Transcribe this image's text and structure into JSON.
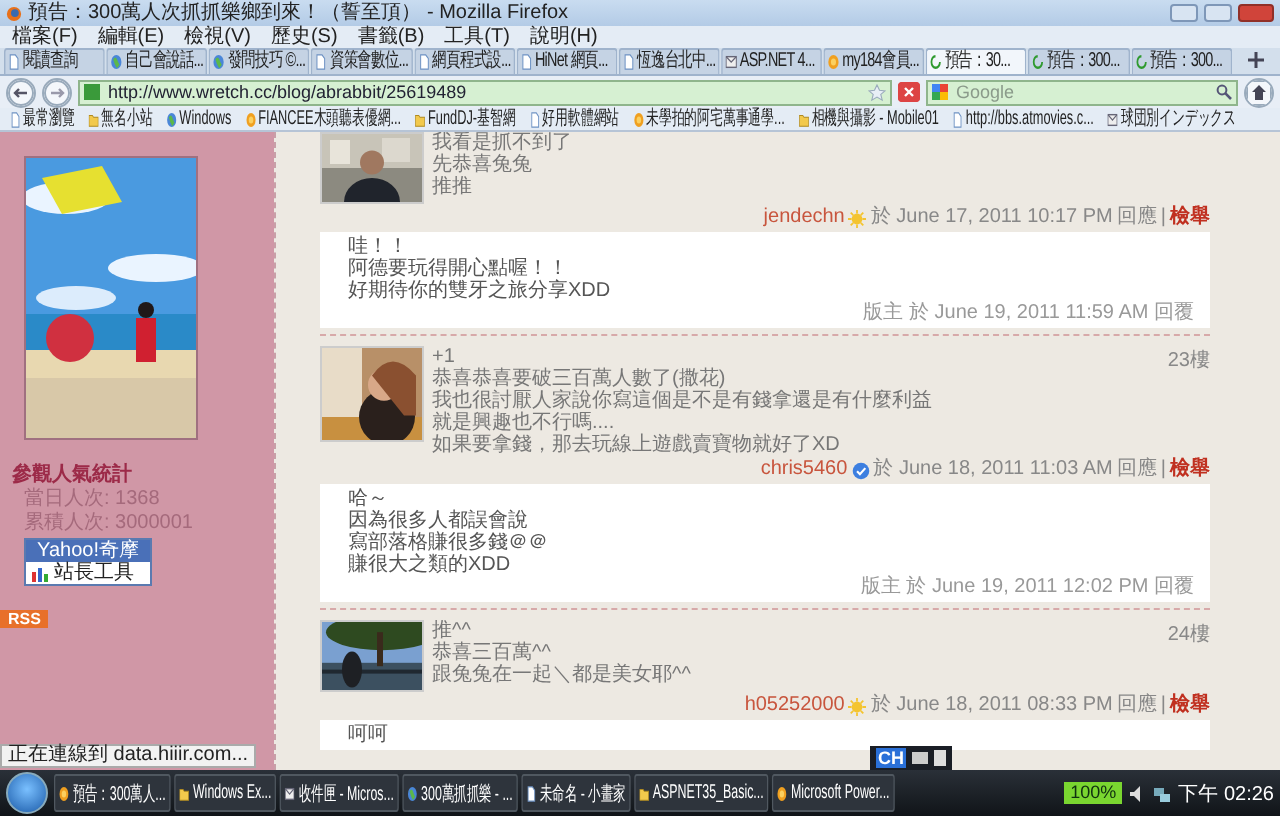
{
  "window": {
    "title": "預告：300萬人次抓抓樂鄉到來！（誓至頂） - Mozilla Firefox"
  },
  "menu": [
    "檔案(F)",
    "編輯(E)",
    "檢視(V)",
    "歷史(S)",
    "書籤(B)",
    "工具(T)",
    "說明(H)"
  ],
  "tabs": [
    {
      "label": "閱讀查詢",
      "selected": false
    },
    {
      "label": "自己會說話...",
      "selected": false
    },
    {
      "label": "發問技巧 ©...",
      "selected": false
    },
    {
      "label": "資策會數位...",
      "selected": false
    },
    {
      "label": "網頁程式設...",
      "selected": false
    },
    {
      "label": "HiNet 網頁...",
      "selected": false
    },
    {
      "label": "恆逸台北中...",
      "selected": false
    },
    {
      "label": "ASP.NET 4...",
      "selected": false
    },
    {
      "label": "my184會員...",
      "selected": false
    },
    {
      "label": "預告：30...",
      "selected": true
    },
    {
      "label": "預告：300...",
      "selected": false
    },
    {
      "label": "預告：300...",
      "selected": false
    }
  ],
  "address": {
    "value": "http://www.wretch.cc/blog/abrabbit/25619489"
  },
  "search": {
    "placeholder": "Google"
  },
  "bookmarks": [
    "最常瀏覽",
    "無名小站",
    "Windows",
    "FIANCEE木頭聽表優網...",
    "FundDJ-基智網",
    "好用軟體網站",
    "未學拍的阿宅萬事通學...",
    "相機與攝影 - Mobile01",
    "http://bbs.atmovies.c...",
    "球団別インデックス"
  ],
  "sidebar": {
    "stats_title": "參觀人氣統計",
    "stats": [
      "當日人次: 1368",
      "累積人次: 3000001"
    ],
    "badge_top": "Yahoo!奇摩",
    "badge_bottom": "站長工具",
    "rss": "RSS"
  },
  "comments": [
    {
      "lines": [
        "我看是抓不到了",
        "先恭喜兔兔",
        "推推"
      ],
      "author": "jendechn",
      "time": "於 June 17, 2011 10:17 PM",
      "reply_link": "回應",
      "separator": "|",
      "report_link": "檢舉",
      "reply": {
        "lines": [
          "哇！！",
          "阿德要玩得開心點喔！！",
          "好期待你的雙牙之旅分享XDD"
        ],
        "meta": "版主 於 June 19, 2011 11:59 AM 回覆"
      }
    },
    {
      "floor": "23樓",
      "lines": [
        "+1",
        "恭喜恭喜要破三百萬人數了(撒花)",
        "我也很討厭人家說你寫這個是不是有錢拿還是有什麼利益",
        "就是興趣也不行嗎....",
        "如果要拿錢，那去玩線上遊戲賣寶物就好了XD"
      ],
      "author": "chris5460",
      "time": "於 June 18, 2011 11:03 AM",
      "reply_link": "回應",
      "separator": "|",
      "report_link": "檢舉",
      "reply": {
        "lines": [
          "哈～",
          "因為很多人都誤會說",
          "寫部落格賺很多錢＠＠",
          "賺很大之類的XDD"
        ],
        "meta": "版主 於 June 19, 2011 12:02 PM 回覆"
      }
    },
    {
      "floor": "24樓",
      "lines": [
        "推^^",
        "恭喜三百萬^^",
        "跟兔兔在一起＼都是美女耶^^"
      ],
      "author": "h05252000",
      "time": "於 June 18, 2011 08:33 PM",
      "reply_link": "回應",
      "separator": "|",
      "report_link": "檢舉",
      "reply": {
        "lines": [
          "呵呵"
        ]
      }
    }
  ],
  "status_bar": "正在連線到 data.hiiir.com...",
  "language_bar": "CH",
  "taskbar": {
    "items": [
      "預告：300萬人...",
      "Windows Ex...",
      "收件匣 - Micros...",
      "300萬抓抓樂 - ...",
      "未命名 - 小畫家",
      "ASPNET35_Basic...",
      "Microsoft Power..."
    ],
    "battery": "100%",
    "clock": "下午 02:26"
  }
}
